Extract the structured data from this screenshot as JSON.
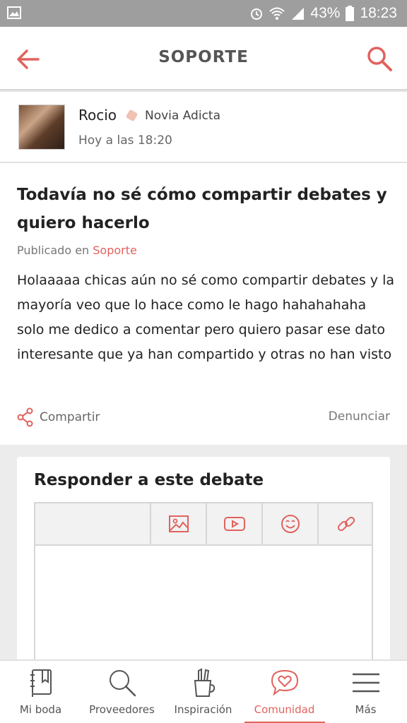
{
  "status_bar": {
    "battery": "43%",
    "time": "18:23"
  },
  "header": {
    "title": "SOPORTE",
    "back_icon": "arrow-left-icon",
    "search_icon": "search-icon"
  },
  "post": {
    "author": "Rocio",
    "rank": "Novia Adicta",
    "time": "Hoy a las 18:20",
    "title": "Todavía no sé cómo compartir debates y quiero hacerlo",
    "published_prefix": "Publicado en",
    "category": "Soporte",
    "body": "Holaaaaa chicas aún no sé como compartir debates y la mayoría veo que lo hace como le hago hahahahaha solo me dedico a comentar pero quiero pasar ese dato interesante que ya han compartido y otras no han visto",
    "share_label": "Compartir",
    "report_label": "Denunciar"
  },
  "reply": {
    "title": "Responder a este debate",
    "toolbar": [
      "image-icon",
      "video-icon",
      "emoji-icon",
      "link-icon"
    ]
  },
  "bottom_nav": {
    "items": [
      {
        "label": "Mi boda",
        "icon": "notebook-icon"
      },
      {
        "label": "Proveedores",
        "icon": "search-icon"
      },
      {
        "label": "Inspiración",
        "icon": "pencil-cup-icon"
      },
      {
        "label": "Comunidad",
        "icon": "heart-chat-icon"
      },
      {
        "label": "Más",
        "icon": "menu-icon"
      }
    ],
    "active": "Comunidad"
  },
  "colors": {
    "accent": "#e1625e",
    "status_bar": "#9e9e9e"
  }
}
